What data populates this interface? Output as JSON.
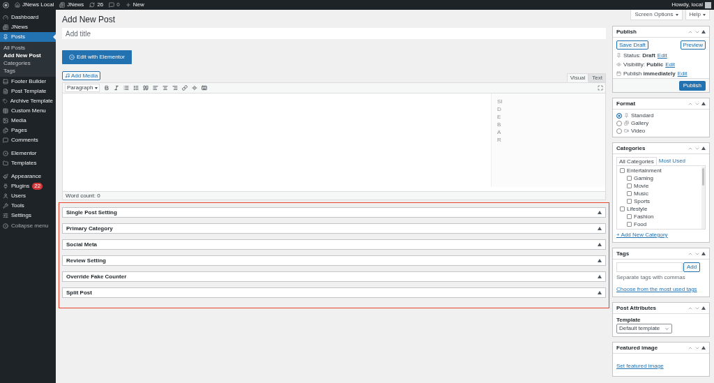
{
  "admin_bar": {
    "site": "JNews Local",
    "theme": "JNews",
    "updates": "26",
    "comments": "0",
    "new": "New",
    "greeting": "Howdy, local"
  },
  "sidebar": {
    "sections": [
      [
        {
          "label": "Dashboard",
          "selected": false
        },
        {
          "label": "JNews",
          "selected": false
        },
        {
          "label": "Posts",
          "selected": true,
          "children": [
            {
              "label": "All Posts",
              "selected": false
            },
            {
              "label": "Add New Post",
              "selected": true
            },
            {
              "label": "Categories",
              "selected": false
            },
            {
              "label": "Tags",
              "selected": false
            }
          ]
        },
        {
          "label": "Footer Builder",
          "selected": false
        },
        {
          "label": "Post Template",
          "selected": false
        },
        {
          "label": "Archive Template",
          "selected": false
        },
        {
          "label": "Custom Menu",
          "selected": false
        },
        {
          "label": "Media",
          "selected": false
        },
        {
          "label": "Pages",
          "selected": false
        },
        {
          "label": "Comments",
          "selected": false
        }
      ],
      [
        {
          "label": "Elementor",
          "selected": false
        },
        {
          "label": "Templates",
          "selected": false
        }
      ],
      [
        {
          "label": "Appearance",
          "selected": false
        },
        {
          "label": "Plugins",
          "selected": false,
          "badge": "22"
        },
        {
          "label": "Users",
          "selected": false
        },
        {
          "label": "Tools",
          "selected": false
        },
        {
          "label": "Settings",
          "selected": false
        }
      ]
    ],
    "collapse": "Collapse menu"
  },
  "screen_options": "Screen Options",
  "help": "Help",
  "page_title": "Add New Post",
  "title_field": {
    "placeholder": "Add title"
  },
  "elementor_button": "Edit with Elementor",
  "editor": {
    "add_media": "Add Media",
    "tabs": [
      {
        "label": "Visual",
        "selected": true
      },
      {
        "label": "Text",
        "selected": false
      }
    ],
    "format": "Paragraph",
    "sidebar_label": "SIDEBAR",
    "word_count": "Word count: 0"
  },
  "metaboxes": [
    {
      "title": "Single Post Setting"
    },
    {
      "title": "Primary Category"
    },
    {
      "title": "Social Meta"
    },
    {
      "title": "Review Setting"
    },
    {
      "title": "Override Fake Counter"
    },
    {
      "title": "Split Post"
    }
  ],
  "publish": {
    "title": "Publish",
    "save_draft": "Save Draft",
    "preview": "Preview",
    "rows": [
      {
        "label": "Status:",
        "value": "Draft",
        "link": "Edit"
      },
      {
        "label": "Visibility:",
        "value": "Public",
        "link": "Edit"
      },
      {
        "label": "Publish",
        "value": "immediately",
        "link": "Edit"
      }
    ],
    "button": "Publish"
  },
  "format": {
    "title": "Format",
    "options": [
      {
        "label": "Standard",
        "selected": true
      },
      {
        "label": "Gallery",
        "selected": false
      },
      {
        "label": "Video",
        "selected": false
      }
    ]
  },
  "categories": {
    "title": "Categories",
    "tabs": [
      {
        "label": "All Categories",
        "selected": true
      },
      {
        "label": "Most Used",
        "selected": false
      }
    ],
    "items": [
      {
        "label": "Entertainment",
        "checked": false,
        "children": [
          {
            "label": "Gaming",
            "checked": false
          },
          {
            "label": "Movie",
            "checked": false
          },
          {
            "label": "Music",
            "checked": false
          },
          {
            "label": "Sports",
            "checked": false
          }
        ]
      },
      {
        "label": "Lifestyle",
        "checked": false,
        "children": [
          {
            "label": "Fashion",
            "checked": false
          },
          {
            "label": "Food",
            "checked": false
          }
        ]
      }
    ],
    "add_link": "+ Add New Category"
  },
  "tags": {
    "title": "Tags",
    "add": "Add",
    "hint": "Separate tags with commas",
    "link": "Choose from the most used tags"
  },
  "post_attributes": {
    "title": "Post Attributes",
    "label": "Template",
    "value": "Default template"
  },
  "featured_image": {
    "title": "Featured image",
    "link": "Set featured image"
  }
}
